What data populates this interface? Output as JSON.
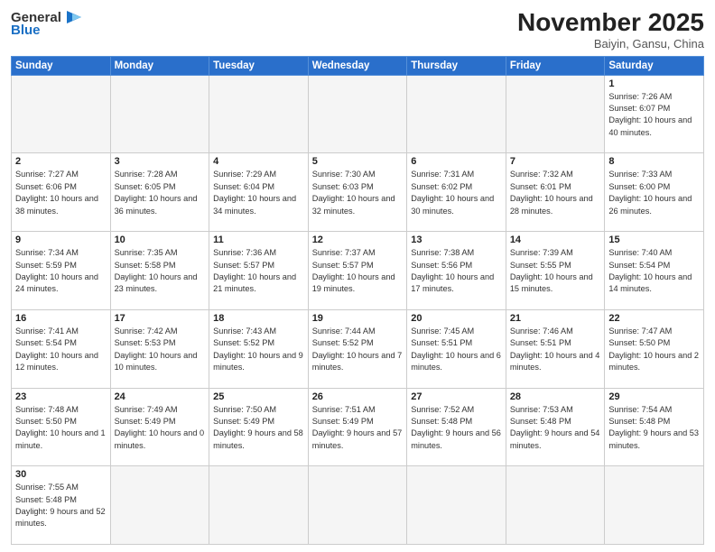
{
  "logo": {
    "line1": "General",
    "line2": "Blue"
  },
  "title": "November 2025",
  "subtitle": "Baiyin, Gansu, China",
  "weekdays": [
    "Sunday",
    "Monday",
    "Tuesday",
    "Wednesday",
    "Thursday",
    "Friday",
    "Saturday"
  ],
  "days": [
    {
      "num": "",
      "info": ""
    },
    {
      "num": "",
      "info": ""
    },
    {
      "num": "",
      "info": ""
    },
    {
      "num": "",
      "info": ""
    },
    {
      "num": "",
      "info": ""
    },
    {
      "num": "",
      "info": ""
    },
    {
      "num": "1",
      "info": "Sunrise: 7:26 AM\nSunset: 6:07 PM\nDaylight: 10 hours\nand 40 minutes."
    },
    {
      "num": "2",
      "info": "Sunrise: 7:27 AM\nSunset: 6:06 PM\nDaylight: 10 hours\nand 38 minutes."
    },
    {
      "num": "3",
      "info": "Sunrise: 7:28 AM\nSunset: 6:05 PM\nDaylight: 10 hours\nand 36 minutes."
    },
    {
      "num": "4",
      "info": "Sunrise: 7:29 AM\nSunset: 6:04 PM\nDaylight: 10 hours\nand 34 minutes."
    },
    {
      "num": "5",
      "info": "Sunrise: 7:30 AM\nSunset: 6:03 PM\nDaylight: 10 hours\nand 32 minutes."
    },
    {
      "num": "6",
      "info": "Sunrise: 7:31 AM\nSunset: 6:02 PM\nDaylight: 10 hours\nand 30 minutes."
    },
    {
      "num": "7",
      "info": "Sunrise: 7:32 AM\nSunset: 6:01 PM\nDaylight: 10 hours\nand 28 minutes."
    },
    {
      "num": "8",
      "info": "Sunrise: 7:33 AM\nSunset: 6:00 PM\nDaylight: 10 hours\nand 26 minutes."
    },
    {
      "num": "9",
      "info": "Sunrise: 7:34 AM\nSunset: 5:59 PM\nDaylight: 10 hours\nand 24 minutes."
    },
    {
      "num": "10",
      "info": "Sunrise: 7:35 AM\nSunset: 5:58 PM\nDaylight: 10 hours\nand 23 minutes."
    },
    {
      "num": "11",
      "info": "Sunrise: 7:36 AM\nSunset: 5:57 PM\nDaylight: 10 hours\nand 21 minutes."
    },
    {
      "num": "12",
      "info": "Sunrise: 7:37 AM\nSunset: 5:57 PM\nDaylight: 10 hours\nand 19 minutes."
    },
    {
      "num": "13",
      "info": "Sunrise: 7:38 AM\nSunset: 5:56 PM\nDaylight: 10 hours\nand 17 minutes."
    },
    {
      "num": "14",
      "info": "Sunrise: 7:39 AM\nSunset: 5:55 PM\nDaylight: 10 hours\nand 15 minutes."
    },
    {
      "num": "15",
      "info": "Sunrise: 7:40 AM\nSunset: 5:54 PM\nDaylight: 10 hours\nand 14 minutes."
    },
    {
      "num": "16",
      "info": "Sunrise: 7:41 AM\nSunset: 5:54 PM\nDaylight: 10 hours\nand 12 minutes."
    },
    {
      "num": "17",
      "info": "Sunrise: 7:42 AM\nSunset: 5:53 PM\nDaylight: 10 hours\nand 10 minutes."
    },
    {
      "num": "18",
      "info": "Sunrise: 7:43 AM\nSunset: 5:52 PM\nDaylight: 10 hours\nand 9 minutes."
    },
    {
      "num": "19",
      "info": "Sunrise: 7:44 AM\nSunset: 5:52 PM\nDaylight: 10 hours\nand 7 minutes."
    },
    {
      "num": "20",
      "info": "Sunrise: 7:45 AM\nSunset: 5:51 PM\nDaylight: 10 hours\nand 6 minutes."
    },
    {
      "num": "21",
      "info": "Sunrise: 7:46 AM\nSunset: 5:51 PM\nDaylight: 10 hours\nand 4 minutes."
    },
    {
      "num": "22",
      "info": "Sunrise: 7:47 AM\nSunset: 5:50 PM\nDaylight: 10 hours\nand 2 minutes."
    },
    {
      "num": "23",
      "info": "Sunrise: 7:48 AM\nSunset: 5:50 PM\nDaylight: 10 hours\nand 1 minute."
    },
    {
      "num": "24",
      "info": "Sunrise: 7:49 AM\nSunset: 5:49 PM\nDaylight: 10 hours\nand 0 minutes."
    },
    {
      "num": "25",
      "info": "Sunrise: 7:50 AM\nSunset: 5:49 PM\nDaylight: 9 hours\nand 58 minutes."
    },
    {
      "num": "26",
      "info": "Sunrise: 7:51 AM\nSunset: 5:49 PM\nDaylight: 9 hours\nand 57 minutes."
    },
    {
      "num": "27",
      "info": "Sunrise: 7:52 AM\nSunset: 5:48 PM\nDaylight: 9 hours\nand 56 minutes."
    },
    {
      "num": "28",
      "info": "Sunrise: 7:53 AM\nSunset: 5:48 PM\nDaylight: 9 hours\nand 54 minutes."
    },
    {
      "num": "29",
      "info": "Sunrise: 7:54 AM\nSunset: 5:48 PM\nDaylight: 9 hours\nand 53 minutes."
    },
    {
      "num": "30",
      "info": "Sunrise: 7:55 AM\nSunset: 5:48 PM\nDaylight: 9 hours\nand 52 minutes."
    },
    {
      "num": "",
      "info": ""
    },
    {
      "num": "",
      "info": ""
    },
    {
      "num": "",
      "info": ""
    },
    {
      "num": "",
      "info": ""
    },
    {
      "num": "",
      "info": ""
    },
    {
      "num": "",
      "info": ""
    }
  ]
}
